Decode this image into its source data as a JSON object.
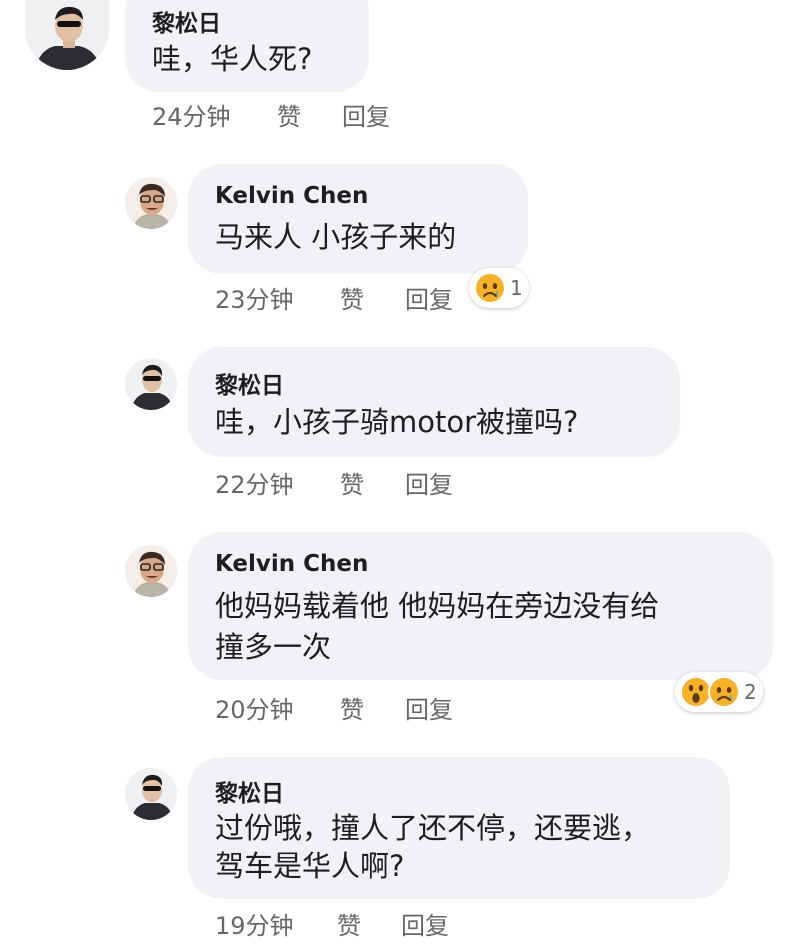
{
  "comments": [
    {
      "author": "黎松日",
      "text": [
        "哇，华人死?"
      ],
      "time": "24分钟",
      "like_label": "赞",
      "reply_label": "回复",
      "avatar": "profile-photo-man-sunglasses"
    },
    {
      "author": "Kelvin Chen",
      "text": [
        "马来人 小孩子来的"
      ],
      "time": "23分钟",
      "like_label": "赞",
      "reply_label": "回复",
      "avatar": "profile-photo-man-glasses",
      "reactions": {
        "icons": [
          "sad-face-icon"
        ],
        "count": "1"
      }
    },
    {
      "author": "黎松日",
      "text": [
        "哇，小孩子骑motor被撞吗?"
      ],
      "time": "22分钟",
      "like_label": "赞",
      "reply_label": "回复",
      "avatar": "profile-photo-man-sunglasses"
    },
    {
      "author": "Kelvin Chen",
      "text": [
        "他妈妈载着他 他妈妈在旁边没有给",
        "撞多一次"
      ],
      "time": "20分钟",
      "like_label": "赞",
      "reply_label": "回复",
      "avatar": "profile-photo-man-glasses",
      "reactions": {
        "icons": [
          "wow-face-icon",
          "sad-face-icon"
        ],
        "count": "2"
      }
    },
    {
      "author": "黎松日",
      "text": [
        "过份哦，撞人了还不停，还要逃，",
        "驾车是华人啊?"
      ],
      "time": "19分钟",
      "like_label": "赞",
      "reply_label": "回复",
      "avatar": "profile-photo-man-sunglasses"
    }
  ],
  "colors": {
    "bubble": "#f0f2f5",
    "text": "#1c1e21",
    "meta": "#65676b",
    "reaction_yellow": "#f7b125"
  }
}
